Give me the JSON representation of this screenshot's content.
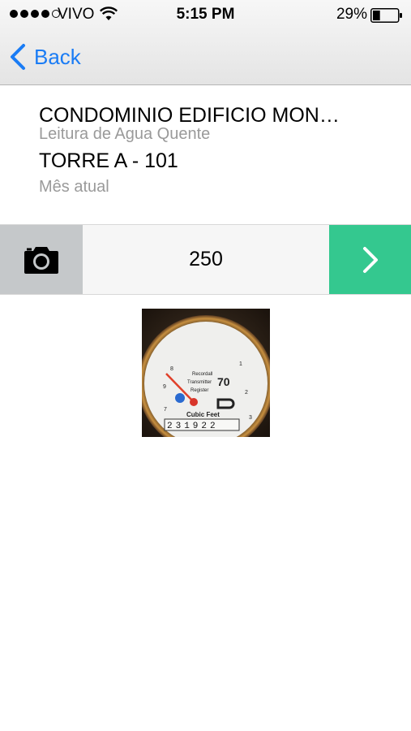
{
  "status_bar": {
    "carrier": "VIVO",
    "time": "5:15 PM",
    "battery_percent": "29%",
    "battery_level": 0.29,
    "signal_bars_filled": 4,
    "signal_bars_total": 5
  },
  "nav": {
    "back_label": "Back",
    "accent_color": "#1a7cf5"
  },
  "header": {
    "title": "CONDOMINIO EDIFICIO MON…",
    "subtitle": "Leitura de Agua Quente",
    "unit": "TORRE A - 101",
    "period": "Mês atual"
  },
  "reading": {
    "value": "250",
    "camera_icon": "camera-icon",
    "next_icon": "chevron-right-icon",
    "next_color": "#34c88f"
  },
  "photo": {
    "meter_brand": "Recordall Transmitter Register",
    "meter_size": "70",
    "meter_unit": "Cubic Feet",
    "meter_digits": "2 3 1 9 2 2"
  }
}
